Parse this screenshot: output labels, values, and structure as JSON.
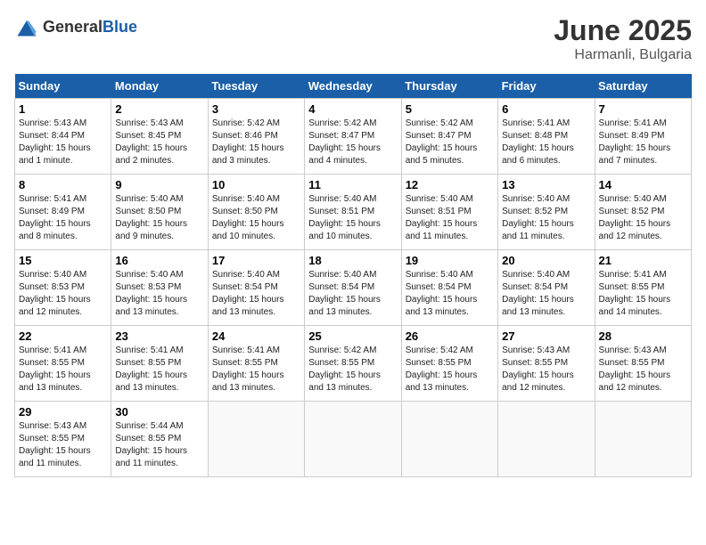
{
  "logo": {
    "text_general": "General",
    "text_blue": "Blue"
  },
  "header": {
    "month_year": "June 2025",
    "location": "Harmanli, Bulgaria"
  },
  "days_of_week": [
    "Sunday",
    "Monday",
    "Tuesday",
    "Wednesday",
    "Thursday",
    "Friday",
    "Saturday"
  ],
  "weeks": [
    [
      {
        "day": "1",
        "sunrise": "5:43 AM",
        "sunset": "8:44 PM",
        "daylight": "15 hours and 1 minute."
      },
      {
        "day": "2",
        "sunrise": "5:43 AM",
        "sunset": "8:45 PM",
        "daylight": "15 hours and 2 minutes."
      },
      {
        "day": "3",
        "sunrise": "5:42 AM",
        "sunset": "8:46 PM",
        "daylight": "15 hours and 3 minutes."
      },
      {
        "day": "4",
        "sunrise": "5:42 AM",
        "sunset": "8:47 PM",
        "daylight": "15 hours and 4 minutes."
      },
      {
        "day": "5",
        "sunrise": "5:42 AM",
        "sunset": "8:47 PM",
        "daylight": "15 hours and 5 minutes."
      },
      {
        "day": "6",
        "sunrise": "5:41 AM",
        "sunset": "8:48 PM",
        "daylight": "15 hours and 6 minutes."
      },
      {
        "day": "7",
        "sunrise": "5:41 AM",
        "sunset": "8:49 PM",
        "daylight": "15 hours and 7 minutes."
      }
    ],
    [
      {
        "day": "8",
        "sunrise": "5:41 AM",
        "sunset": "8:49 PM",
        "daylight": "15 hours and 8 minutes."
      },
      {
        "day": "9",
        "sunrise": "5:40 AM",
        "sunset": "8:50 PM",
        "daylight": "15 hours and 9 minutes."
      },
      {
        "day": "10",
        "sunrise": "5:40 AM",
        "sunset": "8:50 PM",
        "daylight": "15 hours and 10 minutes."
      },
      {
        "day": "11",
        "sunrise": "5:40 AM",
        "sunset": "8:51 PM",
        "daylight": "15 hours and 10 minutes."
      },
      {
        "day": "12",
        "sunrise": "5:40 AM",
        "sunset": "8:51 PM",
        "daylight": "15 hours and 11 minutes."
      },
      {
        "day": "13",
        "sunrise": "5:40 AM",
        "sunset": "8:52 PM",
        "daylight": "15 hours and 11 minutes."
      },
      {
        "day": "14",
        "sunrise": "5:40 AM",
        "sunset": "8:52 PM",
        "daylight": "15 hours and 12 minutes."
      }
    ],
    [
      {
        "day": "15",
        "sunrise": "5:40 AM",
        "sunset": "8:53 PM",
        "daylight": "15 hours and 12 minutes."
      },
      {
        "day": "16",
        "sunrise": "5:40 AM",
        "sunset": "8:53 PM",
        "daylight": "15 hours and 13 minutes."
      },
      {
        "day": "17",
        "sunrise": "5:40 AM",
        "sunset": "8:54 PM",
        "daylight": "15 hours and 13 minutes."
      },
      {
        "day": "18",
        "sunrise": "5:40 AM",
        "sunset": "8:54 PM",
        "daylight": "15 hours and 13 minutes."
      },
      {
        "day": "19",
        "sunrise": "5:40 AM",
        "sunset": "8:54 PM",
        "daylight": "15 hours and 13 minutes."
      },
      {
        "day": "20",
        "sunrise": "5:40 AM",
        "sunset": "8:54 PM",
        "daylight": "15 hours and 13 minutes."
      },
      {
        "day": "21",
        "sunrise": "5:41 AM",
        "sunset": "8:55 PM",
        "daylight": "15 hours and 14 minutes."
      }
    ],
    [
      {
        "day": "22",
        "sunrise": "5:41 AM",
        "sunset": "8:55 PM",
        "daylight": "15 hours and 13 minutes."
      },
      {
        "day": "23",
        "sunrise": "5:41 AM",
        "sunset": "8:55 PM",
        "daylight": "15 hours and 13 minutes."
      },
      {
        "day": "24",
        "sunrise": "5:41 AM",
        "sunset": "8:55 PM",
        "daylight": "15 hours and 13 minutes."
      },
      {
        "day": "25",
        "sunrise": "5:42 AM",
        "sunset": "8:55 PM",
        "daylight": "15 hours and 13 minutes."
      },
      {
        "day": "26",
        "sunrise": "5:42 AM",
        "sunset": "8:55 PM",
        "daylight": "15 hours and 13 minutes."
      },
      {
        "day": "27",
        "sunrise": "5:43 AM",
        "sunset": "8:55 PM",
        "daylight": "15 hours and 12 minutes."
      },
      {
        "day": "28",
        "sunrise": "5:43 AM",
        "sunset": "8:55 PM",
        "daylight": "15 hours and 12 minutes."
      }
    ],
    [
      {
        "day": "29",
        "sunrise": "5:43 AM",
        "sunset": "8:55 PM",
        "daylight": "15 hours and 11 minutes."
      },
      {
        "day": "30",
        "sunrise": "5:44 AM",
        "sunset": "8:55 PM",
        "daylight": "15 hours and 11 minutes."
      },
      null,
      null,
      null,
      null,
      null
    ]
  ]
}
